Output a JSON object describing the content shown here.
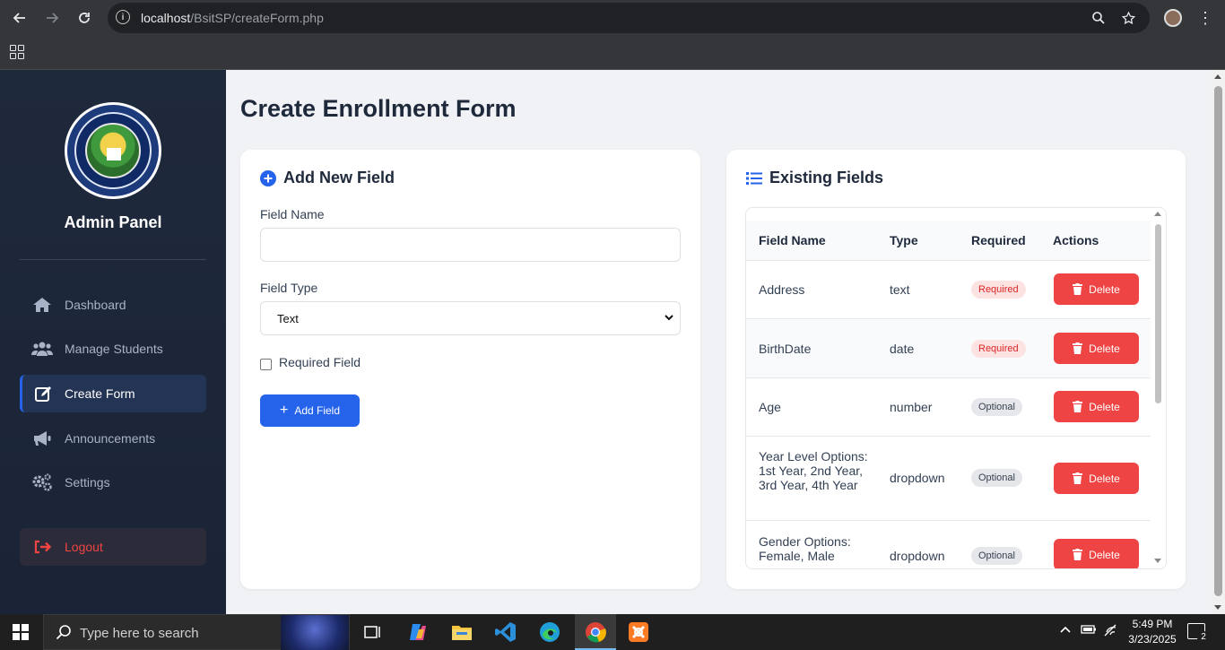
{
  "browser": {
    "url_host": "localhost",
    "url_path": "/BsitSP/createForm.php"
  },
  "sidebar": {
    "title": "Admin Panel",
    "items": [
      {
        "label": "Dashboard",
        "icon": "home-icon"
      },
      {
        "label": "Manage Students",
        "icon": "users-icon"
      },
      {
        "label": "Create Form",
        "icon": "edit-icon",
        "active": true
      },
      {
        "label": "Announcements",
        "icon": "megaphone-icon"
      },
      {
        "label": "Settings",
        "icon": "gears-icon"
      }
    ],
    "logout_label": "Logout"
  },
  "main": {
    "page_title": "Create Enrollment Form"
  },
  "add_field": {
    "heading": "Add New Field",
    "field_name_label": "Field Name",
    "field_name_value": "",
    "field_type_label": "Field Type",
    "field_type_value": "Text",
    "required_label": "Required Field",
    "required_checked": false,
    "button_label": "Add Field"
  },
  "existing_fields": {
    "heading": "Existing Fields",
    "columns": [
      "Field Name",
      "Type",
      "Required",
      "Actions"
    ],
    "rows": [
      {
        "name": "Address",
        "type": "text",
        "required": "Required",
        "action": "Delete"
      },
      {
        "name": "BirthDate",
        "type": "date",
        "required": "Required",
        "action": "Delete"
      },
      {
        "name": "Age",
        "type": "number",
        "required": "Optional",
        "action": "Delete"
      },
      {
        "name": "Year Level Options: 1st Year, 2nd Year, 3rd Year, 4th Year",
        "type": "dropdown",
        "required": "Optional",
        "action": "Delete"
      },
      {
        "name": "Gender Options: Female, Male",
        "type": "dropdown",
        "required": "Optional",
        "action": "Delete"
      }
    ]
  },
  "taskbar": {
    "search_placeholder": "Type here to search",
    "time": "5:49 PM",
    "date": "3/23/2025",
    "notification_count": "2"
  },
  "colors": {
    "accent": "#2563eb",
    "danger": "#ef4444",
    "sidebar_bg": "#1e293b"
  }
}
